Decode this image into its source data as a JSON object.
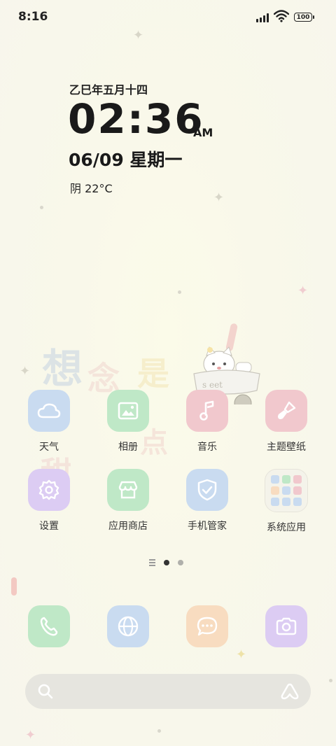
{
  "status_bar": {
    "time": "8:16",
    "battery": "100"
  },
  "clock_widget": {
    "lunar_date": "乙巳年五月十四",
    "time": "02:36",
    "ampm": "AM",
    "date": "06/09 星期一",
    "weather": "阴 22°C"
  },
  "apps": [
    {
      "label": "天气",
      "icon": "weather-cloud-icon",
      "color": "#c9dbf0"
    },
    {
      "label": "相册",
      "icon": "gallery-icon",
      "color": "#bfe8c7"
    },
    {
      "label": "音乐",
      "icon": "music-note-icon",
      "color": "#f1c8cd"
    },
    {
      "label": "主题壁纸",
      "icon": "brush-icon",
      "color": "#f1c8cd"
    },
    {
      "label": "设置",
      "icon": "gear-icon",
      "color": "#dcccf3"
    },
    {
      "label": "应用商店",
      "icon": "store-icon",
      "color": "#bfe8c7"
    },
    {
      "label": "手机管家",
      "icon": "shield-check-icon",
      "color": "#c9dbf0"
    },
    {
      "label": "系统应用",
      "icon": "folder-icon",
      "color": "#f3f2ea"
    }
  ],
  "dock": [
    {
      "name": "phone",
      "icon": "phone-icon",
      "color": "#bfe8c7"
    },
    {
      "name": "browser",
      "icon": "globe-icon",
      "color": "#c9dbf0"
    },
    {
      "name": "messages",
      "icon": "message-icon",
      "color": "#f8dcc0"
    },
    {
      "name": "camera",
      "icon": "camera-icon",
      "color": "#dcccf3"
    }
  ],
  "page_indicator": {
    "pages": 2,
    "current": 1
  },
  "search_bar": {
    "search_icon": "search-icon",
    "assistant_icon": "assistant-icon"
  }
}
